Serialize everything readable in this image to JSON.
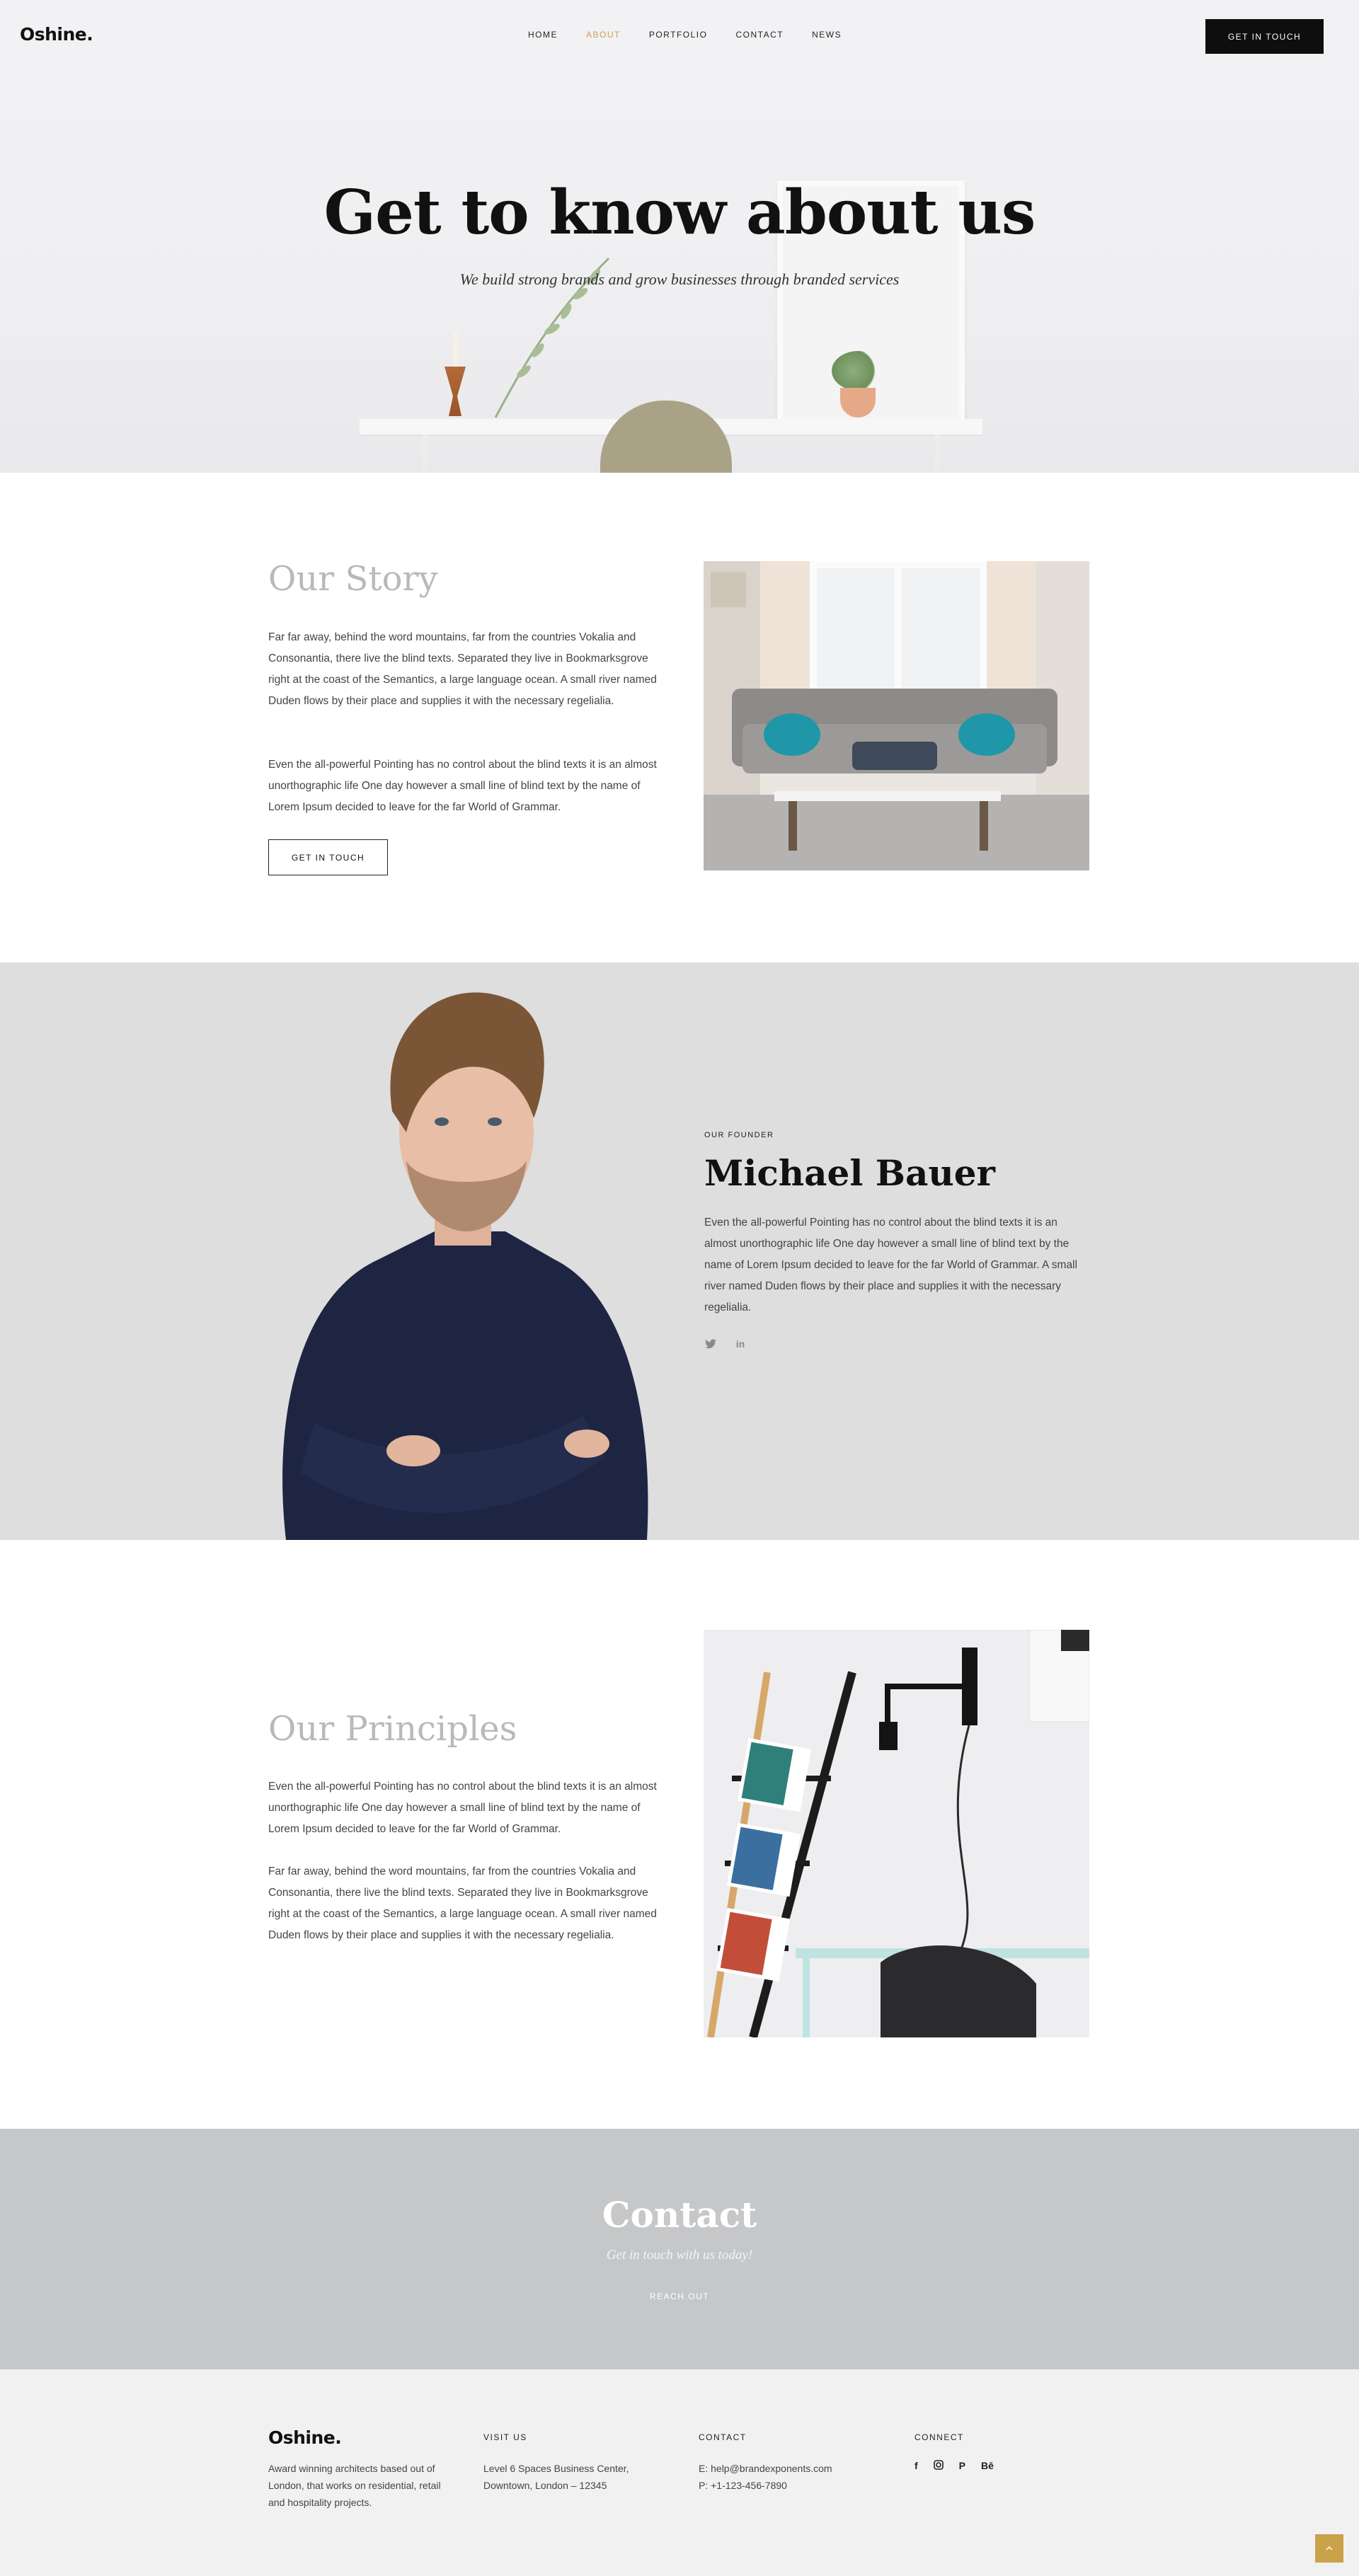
{
  "header": {
    "logo": "Oshine.",
    "nav": [
      {
        "label": "HOME",
        "active": false
      },
      {
        "label": "ABOUT",
        "active": true
      },
      {
        "label": "PORTFOLIO",
        "active": false
      },
      {
        "label": "CONTACT",
        "active": false
      },
      {
        "label": "NEWS",
        "active": false
      }
    ],
    "cta": "GET IN TOUCH"
  },
  "hero": {
    "title": "Get to know about us",
    "subtitle": "We build strong brands and grow businesses through branded services"
  },
  "story": {
    "title": "Our Story",
    "paragraph1": "Far far away, behind the word mountains, far from the countries Vokalia and Consonantia, there live the blind texts. Separated they live in Bookmarksgrove right at the coast of the Semantics, a large language ocean. A small river named Duden flows by their place and supplies it with the necessary regelialia.",
    "paragraph2": "Even the all-powerful Pointing has no control about the blind texts it is an almost unorthographic life One day however a small line of blind text by the name of Lorem Ipsum decided to leave for the far World of Grammar.",
    "button": "GET IN TOUCH"
  },
  "founder": {
    "eyebrow": "OUR FOUNDER",
    "name": "Michael Bauer",
    "bio": "Even the all-powerful Pointing has no control about the blind texts it is an almost unorthographic life One day however a small line of blind text by the name of Lorem Ipsum decided to leave for the far World of Grammar. A small river named Duden flows by their place and supplies it with the necessary regelialia.",
    "social_icons": [
      "twitter-icon",
      "linkedin-icon"
    ]
  },
  "principles": {
    "title": "Our Principles",
    "paragraph1": "Even the all-powerful Pointing has no control about the blind texts it is an almost unorthographic life One day however a small line of blind text by the name of Lorem Ipsum decided to leave for the far World of Grammar.",
    "paragraph2": "Far far away, behind the word mountains, far from the countries Vokalia and Consonantia, there live the blind texts. Separated they live in Bookmarksgrove right at the coast of the Semantics, a large language ocean. A small river named Duden flows by their place and supplies it with the necessary regelialia."
  },
  "contact": {
    "title": "Contact",
    "subtitle": "Get in touch with us today!",
    "link": "REACH OUT"
  },
  "footer": {
    "logo": "Oshine.",
    "about": "Award winning architects based out of London, that works on residential, retail and hospitality projects.",
    "visit_heading": "VISIT US",
    "visit_line1": "Level 6 Spaces Business Center,",
    "visit_line2": "Downtown, London – 12345",
    "contact_heading": "CONTACT",
    "email": "E: help@brandexponents.com",
    "phone": "P: +1-123-456-7890",
    "connect_heading": "CONNECT",
    "social_icons": [
      "facebook-icon",
      "instagram-icon",
      "pinterest-icon",
      "behance-icon"
    ]
  },
  "colors": {
    "accent": "#c9a24a",
    "dark": "#0e0e0e",
    "founder_bg": "#dedede",
    "contact_bg": "#c6c7c9",
    "footer_bg": "#f1f1f1"
  }
}
